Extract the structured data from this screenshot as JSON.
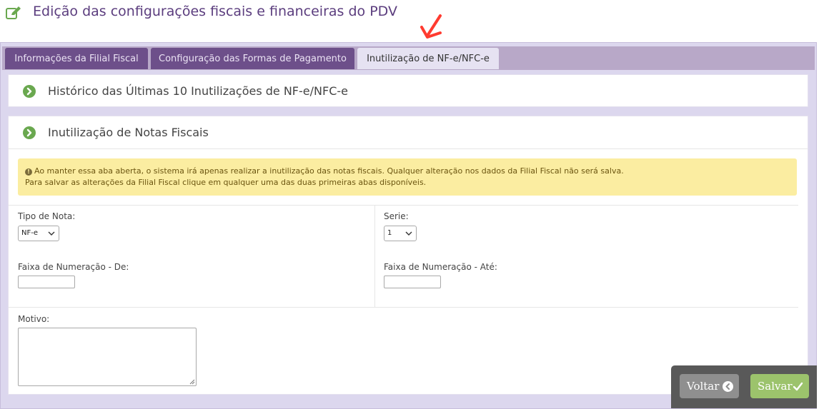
{
  "header": {
    "title": "Edição das configurações fiscais e financeiras do PDV",
    "icon": "edit-icon"
  },
  "tabs": [
    {
      "label": "Informações da Filial Fiscal",
      "active": false
    },
    {
      "label": "Configuração das Formas de Pagamento",
      "active": false
    },
    {
      "label": "Inutilização de NF-e/NFC-e",
      "active": true
    }
  ],
  "history_panel": {
    "title": "Histórico das Últimas 10 Inutilizações de NF-e/NFC-e",
    "icon": "chevron-right-circle-icon"
  },
  "invalidation_panel": {
    "title": "Inutilização de Notas Fiscais",
    "icon": "chevron-right-circle-icon",
    "alert": {
      "line1": "Ao manter essa aba aberta, o sistema irá apenas realizar a inutilização das notas fiscais. Qualquer alteração nos dados da Filial Fiscal não será salva.",
      "line2": "Para salvar as alterações da Filial Fiscal clique em qualquer uma das duas primeiras abas disponíveis.",
      "icon": "info-icon"
    },
    "tipo_nota": {
      "label": "Tipo de Nota:",
      "value": "NF-e"
    },
    "serie": {
      "label": "Serie:",
      "value": "1"
    },
    "faixa_de": {
      "label": "Faixa de Numeração - De:",
      "value": ""
    },
    "faixa_ate": {
      "label": "Faixa de Numeração - Até:",
      "value": ""
    },
    "motivo": {
      "label": "Motivo:",
      "value": ""
    }
  },
  "actions": {
    "back_label": "Voltar",
    "save_label": "Salvar"
  },
  "colors": {
    "title": "#5b3d7e",
    "tab_bg": "#6d4f8a",
    "tab_active_bg": "#e6e2f2",
    "frame_bg": "#dcd7ee",
    "chevron_green": "#6aa84f",
    "alert_bg": "#fbeda1",
    "save_green": "#9cc36c",
    "back_gray": "#8f8f8f",
    "annotation_red": "#ff3b30"
  }
}
